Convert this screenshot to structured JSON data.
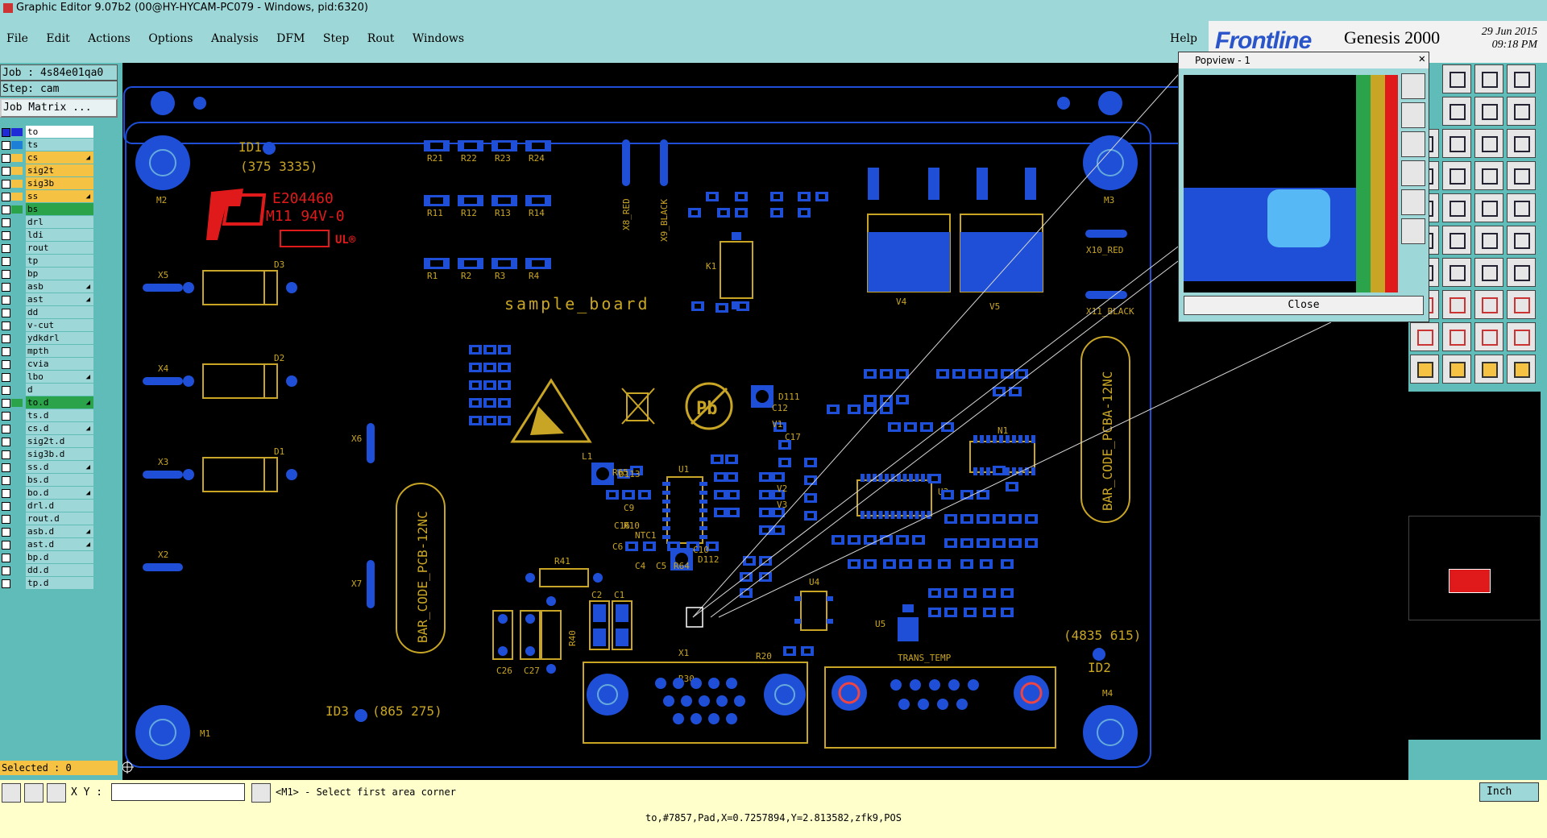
{
  "window": {
    "title": "Graphic Editor 9.07b2 (00@HY-HYCAM-PC079 - Windows, pid:6320)"
  },
  "menu": {
    "items": [
      "File",
      "Edit",
      "Actions",
      "Options",
      "Analysis",
      "DFM",
      "Step",
      "Rout",
      "Windows"
    ],
    "help": "Help"
  },
  "brand": {
    "logo": "Frontline",
    "product": "Genesis 2000",
    "date": "29 Jun 2015",
    "time": "09:18 PM"
  },
  "job": {
    "job_label": "Job : 4s84e01qa0",
    "step_label": "Step: cam",
    "matrix_button": "Job Matrix ..."
  },
  "layers": [
    {
      "name": "to",
      "color": "#1e2bd6",
      "checked": true
    },
    {
      "name": "ts",
      "color": "#1e7fd6"
    },
    {
      "name": "cs",
      "color": "#f6c243",
      "arrow": true
    },
    {
      "name": "sig2t",
      "color": "#f6c243"
    },
    {
      "name": "sig3b",
      "color": "#f6c243"
    },
    {
      "name": "ss",
      "color": "#f6c243",
      "arrow": true
    },
    {
      "name": "bs",
      "color": "#2aa34a"
    },
    {
      "name": "drl",
      "color": ""
    },
    {
      "name": "ldi",
      "color": ""
    },
    {
      "name": "rout",
      "color": ""
    },
    {
      "name": "tp",
      "color": ""
    },
    {
      "name": "bp",
      "color": ""
    },
    {
      "name": "asb",
      "color": "",
      "arrow": true
    },
    {
      "name": "ast",
      "color": "",
      "arrow": true
    },
    {
      "name": "dd",
      "color": ""
    },
    {
      "name": "v-cut",
      "color": ""
    },
    {
      "name": "ydkdrl",
      "color": ""
    },
    {
      "name": "mpth",
      "color": ""
    },
    {
      "name": "cvia",
      "color": ""
    },
    {
      "name": "lbo",
      "color": "",
      "arrow": true
    },
    {
      "name": "d",
      "color": ""
    },
    {
      "name": "to.d",
      "color": "#2aa34a",
      "arrow": true
    },
    {
      "name": "ts.d",
      "color": ""
    },
    {
      "name": "cs.d",
      "color": "",
      "arrow": true
    },
    {
      "name": "sig2t.d",
      "color": ""
    },
    {
      "name": "sig3b.d",
      "color": ""
    },
    {
      "name": "ss.d",
      "color": "",
      "arrow": true
    },
    {
      "name": "bs.d",
      "color": ""
    },
    {
      "name": "bo.d",
      "color": "",
      "arrow": true
    },
    {
      "name": "drl.d",
      "color": ""
    },
    {
      "name": "rout.d",
      "color": ""
    },
    {
      "name": "asb.d",
      "color": "",
      "arrow": true
    },
    {
      "name": "ast.d",
      "color": "",
      "arrow": true
    },
    {
      "name": "bp.d",
      "color": ""
    },
    {
      "name": "dd.d",
      "color": ""
    },
    {
      "name": "tp.d",
      "color": ""
    }
  ],
  "selected_label": "Selected : 0",
  "status": {
    "xy_label": "X Y :",
    "xy_value": "",
    "message": "<M1> - Select first area corner",
    "unit": "Inch"
  },
  "coord_readout": "to,#7857,Pad,X=0.7257894,Y=2.813582,zfk9,POS",
  "popview": {
    "title": "Popview - 1",
    "close": "Close"
  },
  "board": {
    "name": "sample_board",
    "id_marks": [
      "ID1",
      "ID2",
      "ID3"
    ],
    "coords": [
      "(375 3335)",
      "(4835 615)",
      "(865 275)"
    ],
    "ul_text": [
      "E204460",
      "M11 94V-0"
    ],
    "barcodes": [
      "BAR_CODE_PCB-12NC",
      "BAR_CODE_PCBA-12NC"
    ],
    "mount_labels": [
      "M1",
      "M2",
      "M3",
      "M4"
    ],
    "connectors": [
      "X1",
      "TRANS_TEMP"
    ],
    "resistors_top": [
      "R21",
      "R22",
      "R23",
      "R24",
      "R11",
      "R12",
      "R13",
      "R14",
      "R1",
      "R2",
      "R3",
      "R4"
    ],
    "misc_labels": [
      "X5",
      "X4",
      "X3",
      "X2",
      "X6",
      "X7",
      "D1",
      "D2",
      "D3",
      "V4",
      "V5",
      "X10_RED",
      "X11_BLACK",
      "X8_RED",
      "X9_BLACK",
      "K1",
      "U1",
      "U3",
      "U4",
      "U5",
      "N1",
      "D111",
      "D112",
      "D113",
      "R41",
      "R40",
      "C26",
      "C27",
      "C2",
      "C1",
      "C17",
      "L1",
      "NTC1",
      "R65",
      "R30",
      "C12",
      "V1",
      "V2",
      "V3",
      "C16",
      "C6",
      "C9",
      "R10",
      "C4",
      "C5",
      "R64",
      "C10",
      "R20"
    ]
  },
  "colors": {
    "pad": "#1e4fd6",
    "silk": "#c8a524",
    "panel": "#5fbcb9",
    "menu": "#9ed7d7",
    "status": "#ffffcc"
  }
}
